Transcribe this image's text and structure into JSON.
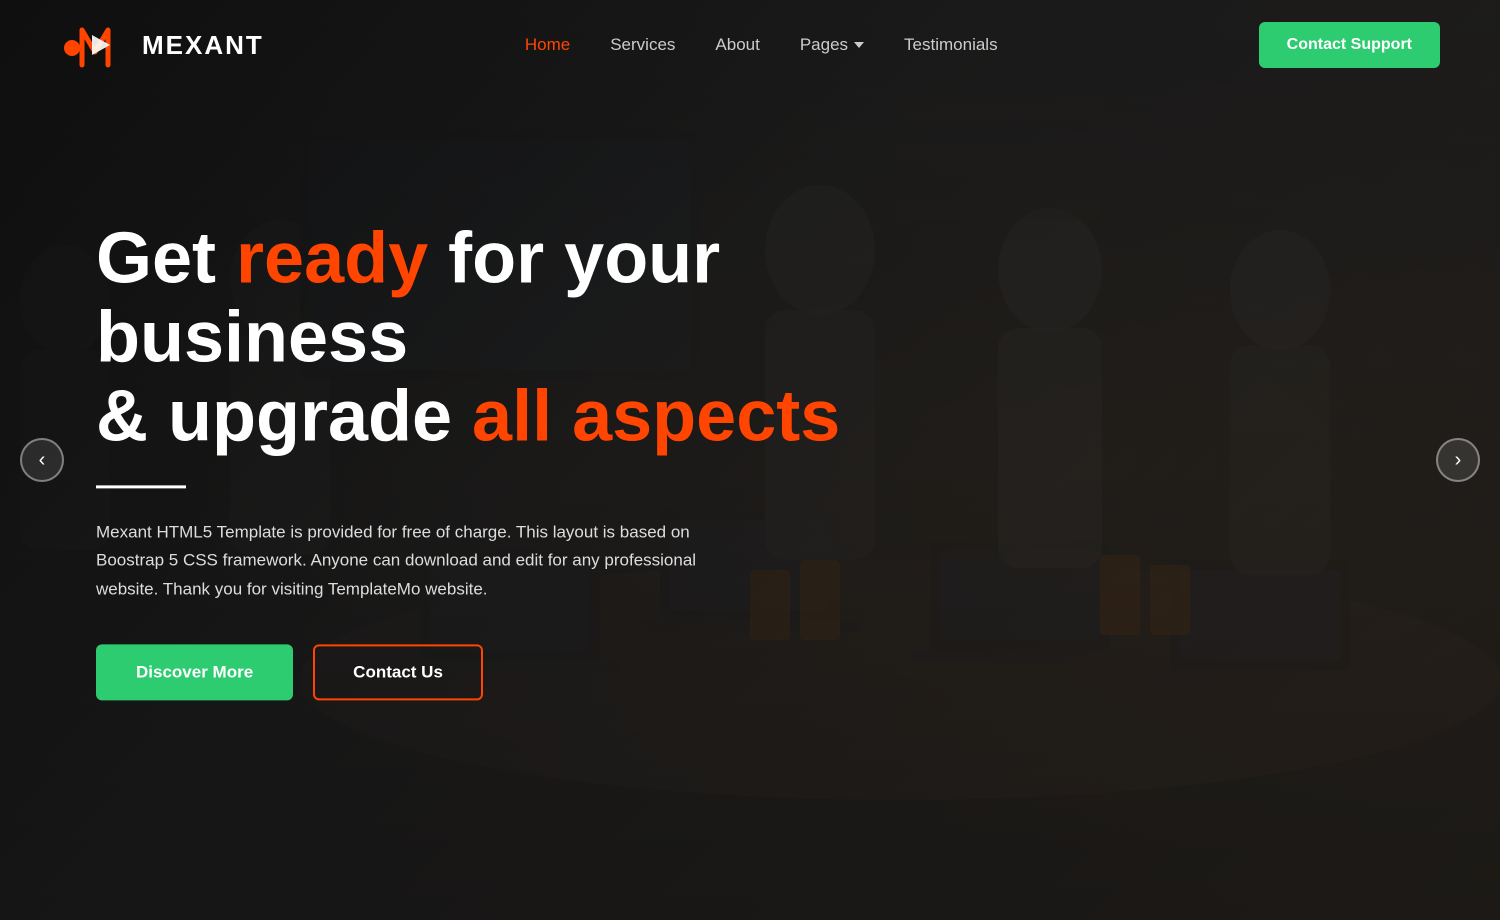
{
  "brand": {
    "logo_text": "MEXANT",
    "logo_icon_alt": "mexant-logo"
  },
  "navbar": {
    "links": [
      {
        "label": "Home",
        "active": true
      },
      {
        "label": "Services",
        "active": false
      },
      {
        "label": "About",
        "active": false
      },
      {
        "label": "Pages",
        "active": false,
        "has_dropdown": true
      },
      {
        "label": "Testimonials",
        "active": false
      }
    ],
    "cta_label": "Contact Support"
  },
  "hero": {
    "headline_part1": "Get ",
    "headline_highlight1": "ready",
    "headline_part2": " for your",
    "headline_line2": "business",
    "headline_line3_part1": "& upgrade ",
    "headline_highlight2": "all aspects",
    "description": "Mexant HTML5 Template is provided for free of charge. This layout is based on Boostrap 5 CSS framework. Anyone can download and edit for any professional website. Thank you for visiting TemplateMo website.",
    "btn_discover": "Discover More",
    "btn_contact": "Contact Us",
    "prev_arrow": "‹",
    "next_arrow": "›"
  },
  "colors": {
    "accent_orange": "#ff4500",
    "accent_green": "#2ecc71",
    "nav_active": "#ff4500",
    "text_white": "#ffffff",
    "text_muted": "#dddddd"
  }
}
